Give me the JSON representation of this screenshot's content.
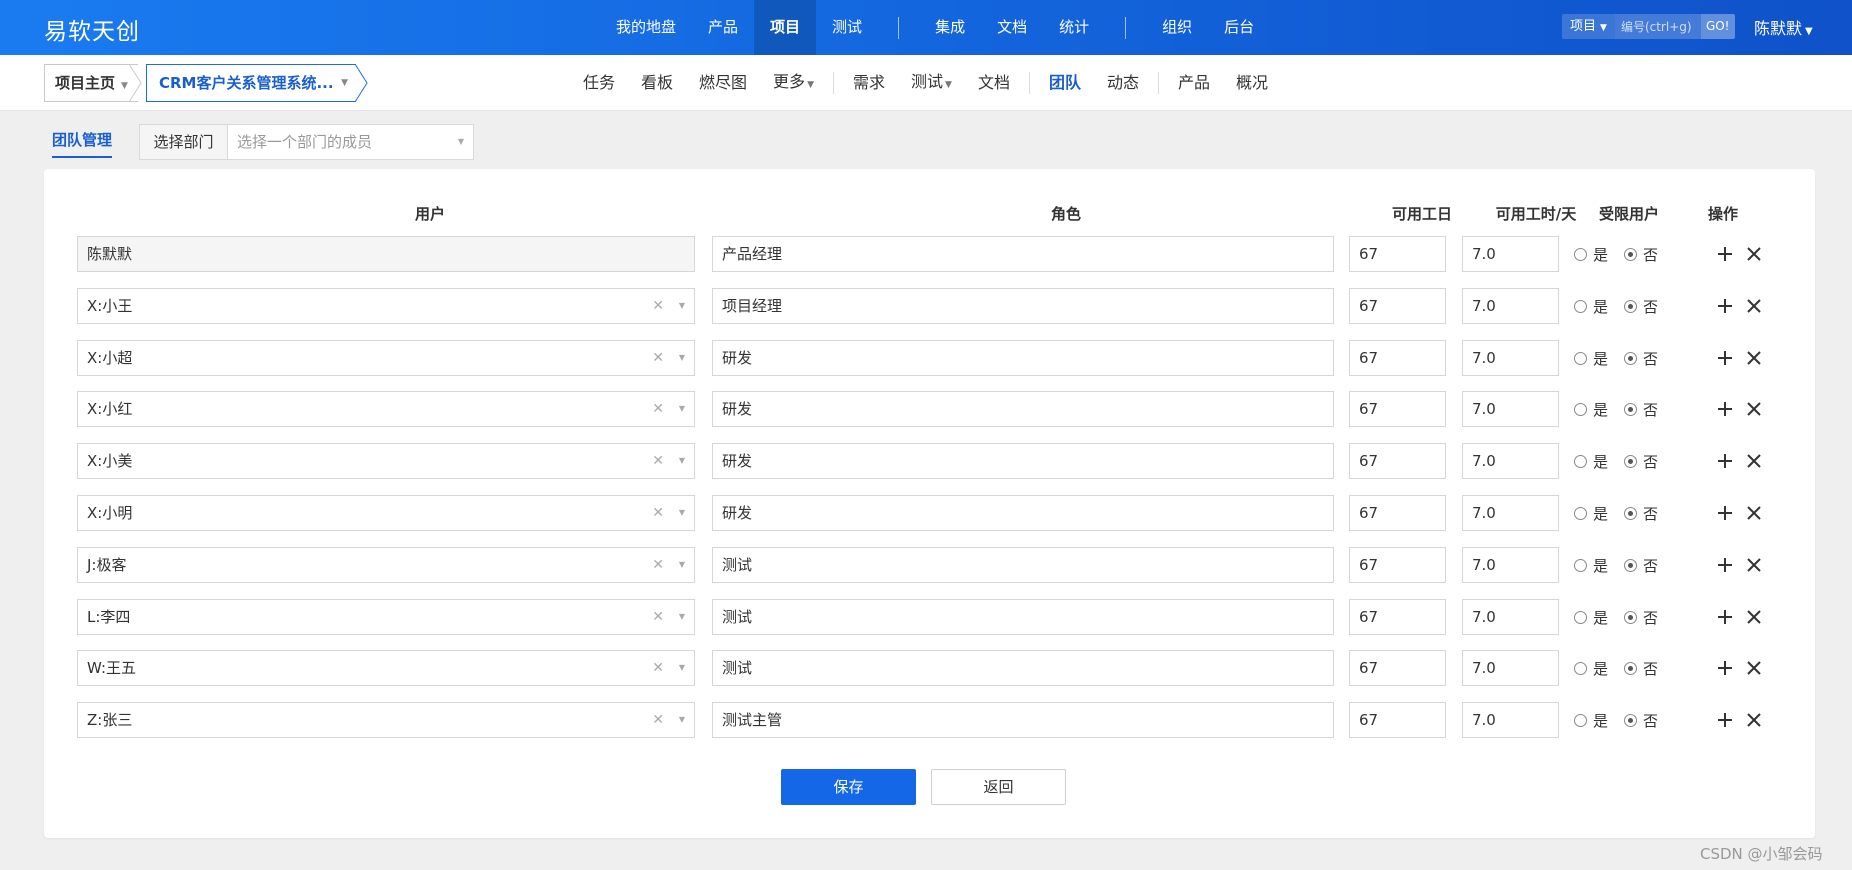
{
  "brand": "易软天创",
  "top_nav": [
    {
      "label": "我的地盘",
      "active": false
    },
    {
      "label": "产品",
      "active": false
    },
    {
      "label": "项目",
      "active": true
    },
    {
      "label": "测试",
      "active": false
    },
    {
      "label": "集成",
      "active": false
    },
    {
      "label": "文档",
      "active": false
    },
    {
      "label": "统计",
      "active": false
    },
    {
      "label": "组织",
      "active": false
    },
    {
      "label": "后台",
      "active": false
    }
  ],
  "search": {
    "type": "项目",
    "placeholder": "编号(ctrl+g)",
    "go": "GO!"
  },
  "user": "陈默默",
  "breadcrumb": {
    "home": "项目主页",
    "project": "CRM客户关系管理系统..."
  },
  "sub_nav": [
    {
      "label": "任务",
      "active": false,
      "dropdown": false
    },
    {
      "label": "看板",
      "active": false,
      "dropdown": false
    },
    {
      "label": "燃尽图",
      "active": false,
      "dropdown": false
    },
    {
      "label": "更多",
      "active": false,
      "dropdown": true
    },
    {
      "label": "需求",
      "active": false,
      "dropdown": false
    },
    {
      "label": "测试",
      "active": false,
      "dropdown": true
    },
    {
      "label": "文档",
      "active": false,
      "dropdown": false
    },
    {
      "label": "团队",
      "active": true,
      "dropdown": false
    },
    {
      "label": "动态",
      "active": false,
      "dropdown": false
    },
    {
      "label": "产品",
      "active": false,
      "dropdown": false
    },
    {
      "label": "概况",
      "active": false,
      "dropdown": false
    }
  ],
  "team": {
    "tab": "团队管理",
    "dept_label": "选择部门",
    "dept_placeholder": "选择一个部门的成员"
  },
  "table": {
    "headers": {
      "user": "用户",
      "role": "角色",
      "days": "可用工日",
      "hours": "可用工时/天",
      "limited": "受限用户",
      "actions": "操作"
    },
    "yes_label": "是",
    "no_label": "否",
    "rows": [
      {
        "user": "陈默默",
        "role": "产品经理",
        "days": "67",
        "hours": "7.0",
        "limited": false,
        "readonly": true
      },
      {
        "user": "X:小王",
        "role": "项目经理",
        "days": "67",
        "hours": "7.0",
        "limited": false,
        "readonly": false
      },
      {
        "user": "X:小超",
        "role": "研发",
        "days": "67",
        "hours": "7.0",
        "limited": false,
        "readonly": false
      },
      {
        "user": "X:小红",
        "role": "研发",
        "days": "67",
        "hours": "7.0",
        "limited": false,
        "readonly": false
      },
      {
        "user": "X:小美",
        "role": "研发",
        "days": "67",
        "hours": "7.0",
        "limited": false,
        "readonly": false
      },
      {
        "user": "X:小明",
        "role": "研发",
        "days": "67",
        "hours": "7.0",
        "limited": false,
        "readonly": false
      },
      {
        "user": "J:极客",
        "role": "测试",
        "days": "67",
        "hours": "7.0",
        "limited": false,
        "readonly": false
      },
      {
        "user": "L:李四",
        "role": "测试",
        "days": "67",
        "hours": "7.0",
        "limited": false,
        "readonly": false
      },
      {
        "user": "W:王五",
        "role": "测试",
        "days": "67",
        "hours": "7.0",
        "limited": false,
        "readonly": false
      },
      {
        "user": "Z:张三",
        "role": "测试主管",
        "days": "67",
        "hours": "7.0",
        "limited": false,
        "readonly": false
      }
    ]
  },
  "buttons": {
    "save": "保存",
    "back": "返回"
  },
  "watermark": "CSDN @小邹会码",
  "colors": {
    "primary": "#1468e8",
    "header_start": "#1a7bf0",
    "header_end": "#0f52c9"
  }
}
